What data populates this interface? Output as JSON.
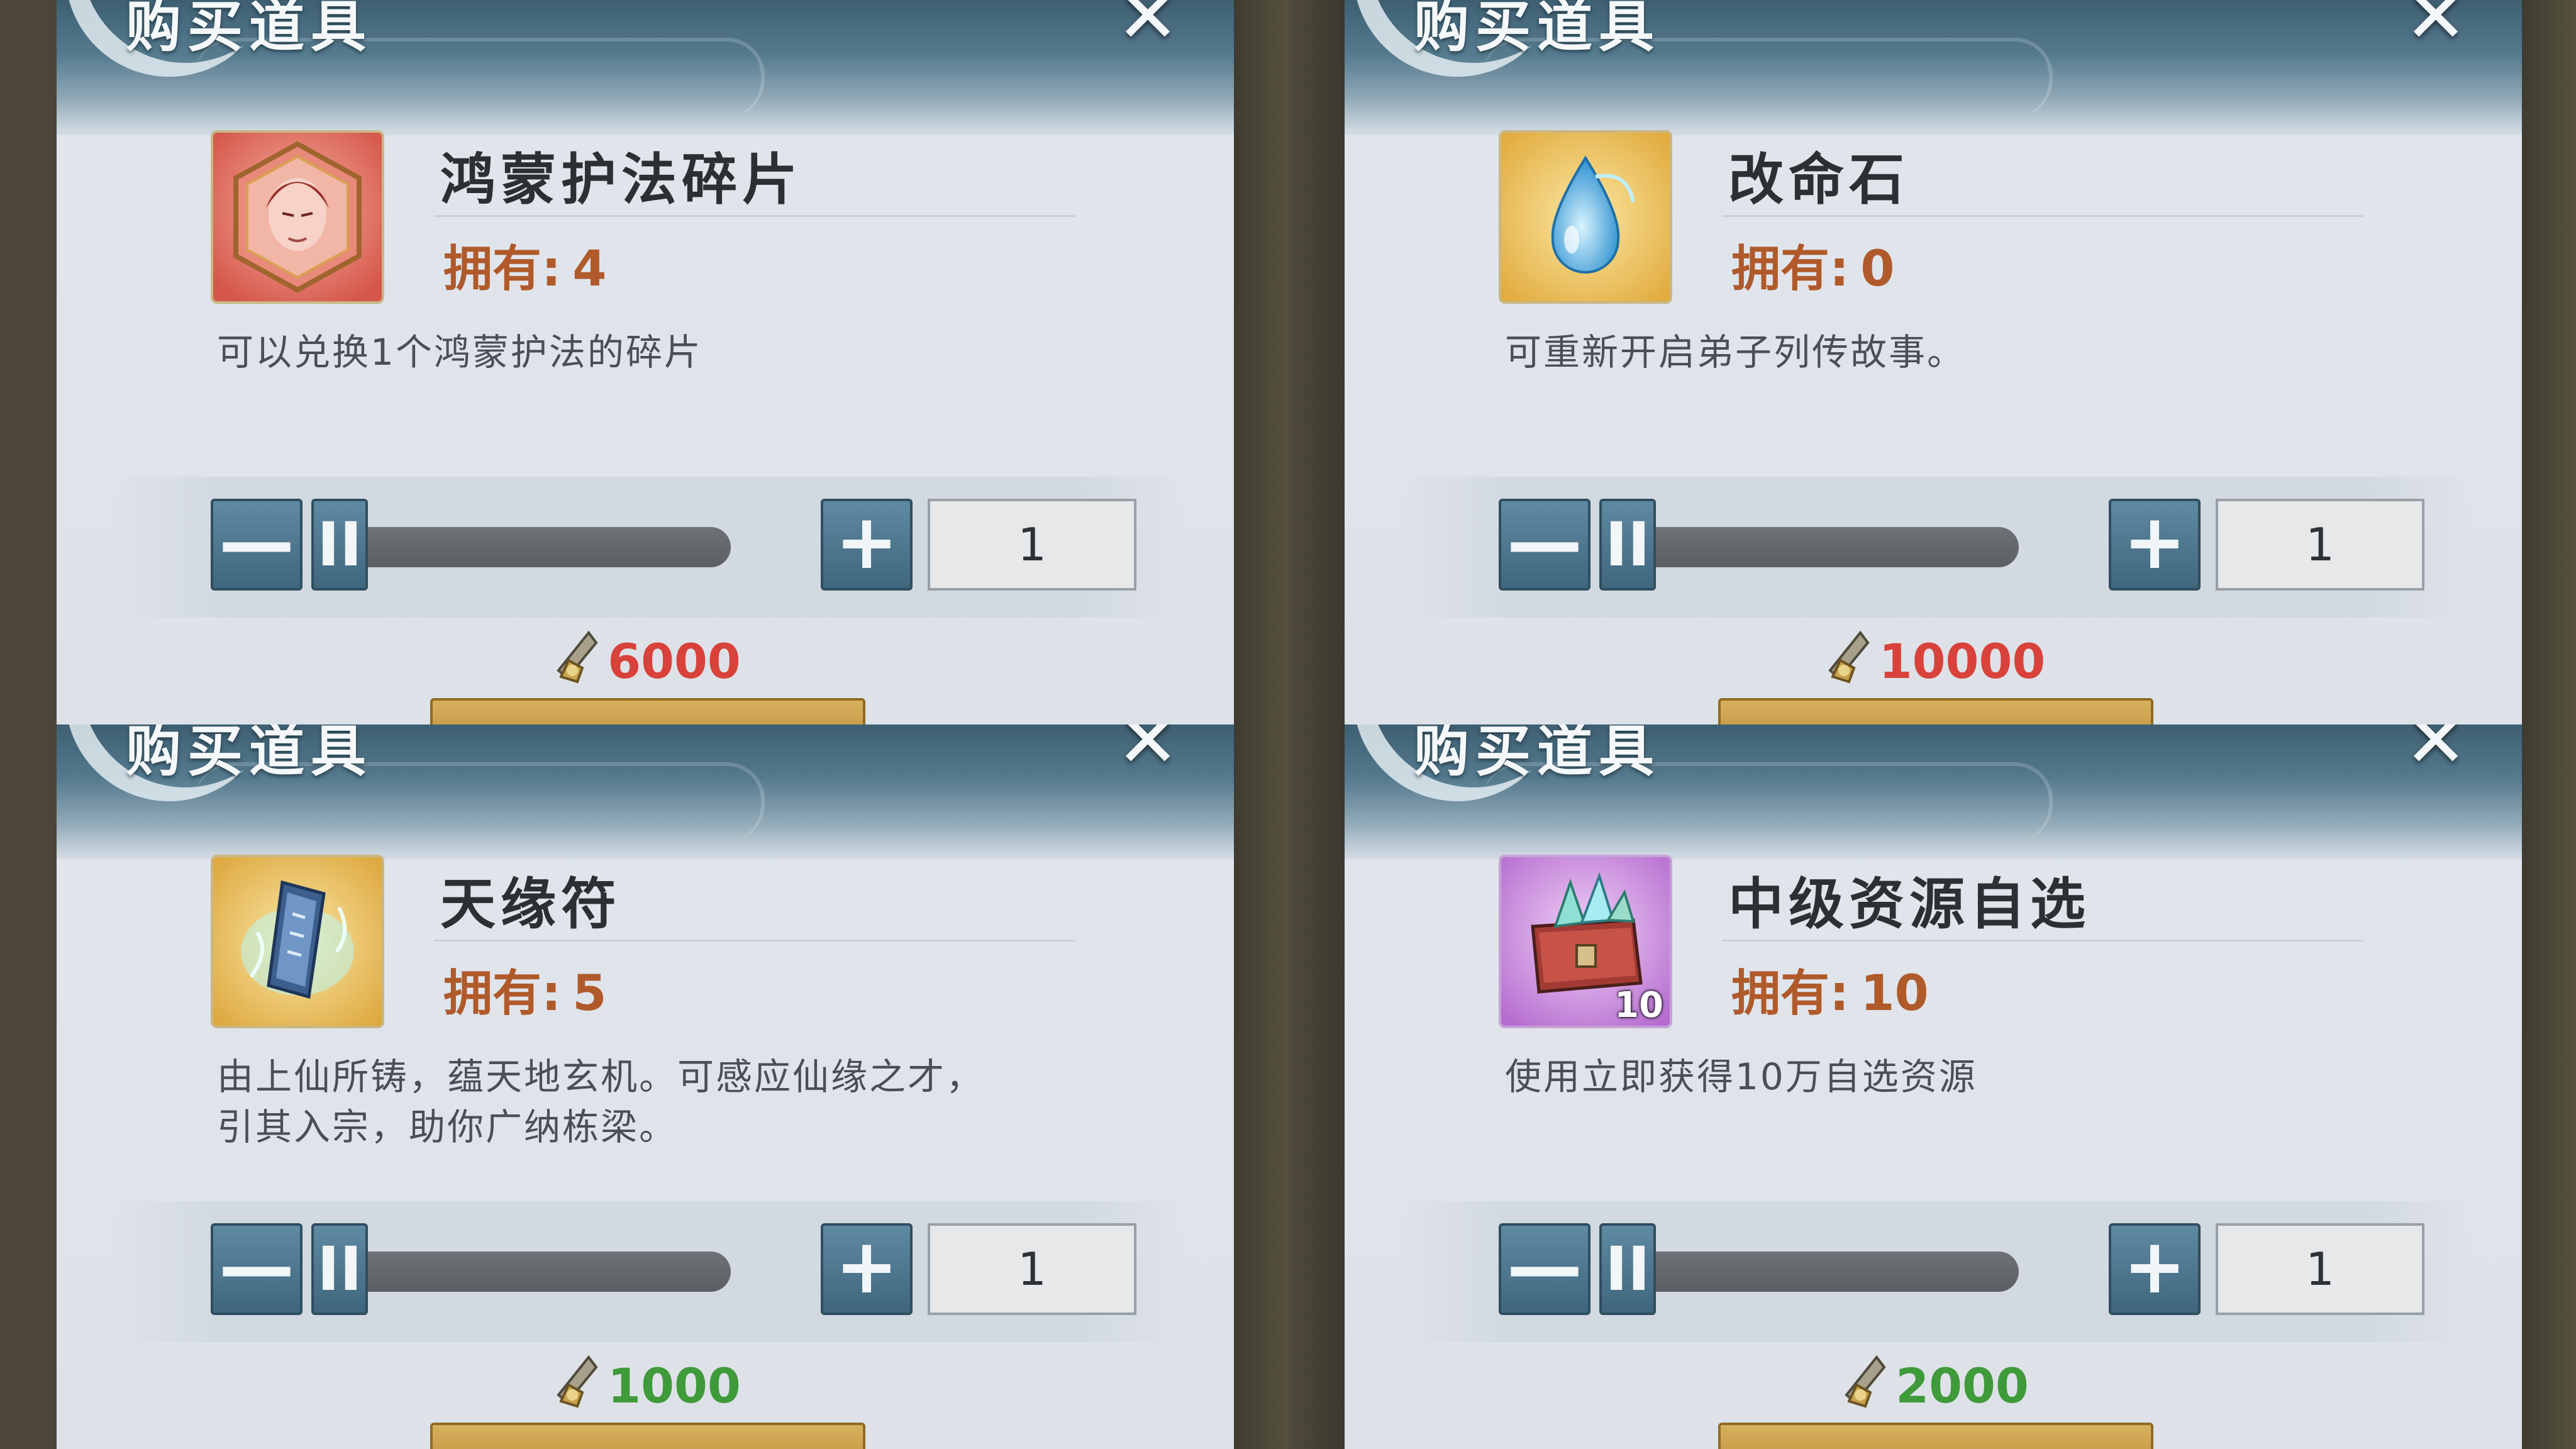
{
  "panels": [
    {
      "header_title": "购买道具",
      "close_label": "✕",
      "item_name": "鸿蒙护法碎片",
      "owned_label": "拥有:",
      "owned_count": "4",
      "description": "可以兑换1个鸿蒙护法的碎片",
      "quantity": "1",
      "slider_level": 0,
      "minus_label": "—",
      "plus_label": "+",
      "handle_label": "II",
      "price": "6000",
      "price_color": "#d8423a",
      "icon": "guardian-portrait-icon"
    },
    {
      "header_title": "购买道具",
      "close_label": "✕",
      "item_name": "改命石",
      "owned_label": "拥有:",
      "owned_count": "0",
      "description": "可重新开启弟子列传故事。",
      "quantity": "1",
      "slider_level": 0,
      "minus_label": "—",
      "plus_label": "+",
      "handle_label": "II",
      "price": "10000",
      "price_color": "#d8423a",
      "icon": "blue-droplet-icon"
    },
    {
      "header_title": "购买道具",
      "close_label": "✕",
      "item_name": "天缘符",
      "owned_label": "拥有:",
      "owned_count": "5",
      "description_lines": [
        "由上仙所铸，蕴天地玄机。可感应仙缘之才，",
        "引其入宗，助你广纳栋梁。"
      ],
      "quantity": "1",
      "slider_level": 0,
      "minus_label": "—",
      "plus_label": "+",
      "handle_label": "II",
      "price": "1000",
      "price_color": "#3f9a3a",
      "icon": "talisman-icon"
    },
    {
      "header_title": "购买道具",
      "close_label": "✕",
      "item_name": "中级资源自选",
      "owned_label": "拥有:",
      "owned_count": "10",
      "description": "使用立即获得10万自选资源",
      "icon_badge": "10",
      "quantity": "1",
      "slider_level": 0,
      "minus_label": "—",
      "plus_label": "+",
      "handle_label": "II",
      "price": "2000",
      "price_color": "#3f9a3a",
      "icon": "treasure-chest-icon"
    }
  ],
  "colors": {
    "owned_text": "#b05a2c",
    "header_dark": "#3e5f72",
    "button_blue": "#4f7890",
    "buy_gold": "#c89e4a"
  },
  "currency_icon": "spirit-stone-coin-icon"
}
